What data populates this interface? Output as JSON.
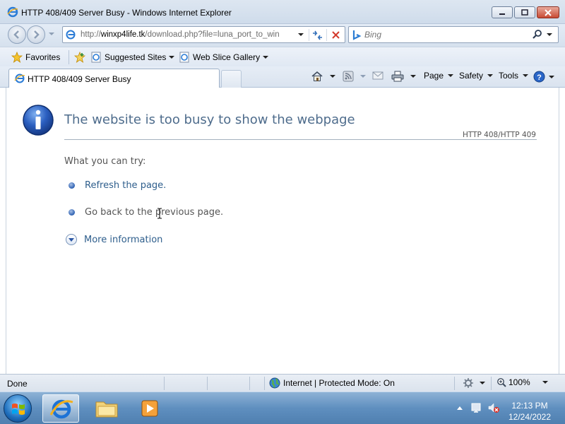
{
  "window": {
    "title": "HTTP 408/409 Server Busy - Windows Internet Explorer"
  },
  "address": {
    "url_prefix": "http://",
    "url_domain": "winxp4life.tk",
    "url_path": "/download.php?file=luna_port_to_win"
  },
  "search": {
    "placeholder": "Bing"
  },
  "favorites_bar": {
    "favorites_label": "Favorites",
    "suggested_label": "Suggested Sites",
    "webslice_label": "Web Slice Gallery"
  },
  "tab": {
    "label": "HTTP 408/409 Server Busy"
  },
  "command_bar": {
    "page_label": "Page",
    "safety_label": "Safety",
    "tools_label": "Tools"
  },
  "error_page": {
    "title": "The website is too busy to show the webpage",
    "code": "HTTP 408/HTTP 409",
    "try_label": "What you can try:",
    "tips": [
      "Refresh the page.",
      "Go back to the previous page."
    ],
    "more_info": "More information"
  },
  "status_bar": {
    "status": "Done",
    "zone": "Internet | Protected Mode: On",
    "zoom": "100%"
  },
  "taskbar": {
    "time": "12:13 PM",
    "date": "12/24/2022"
  },
  "colors": {
    "accent_link": "#2e5e8c",
    "title_text": "#4e6c8c",
    "taskbar": "#5f8fbf"
  }
}
